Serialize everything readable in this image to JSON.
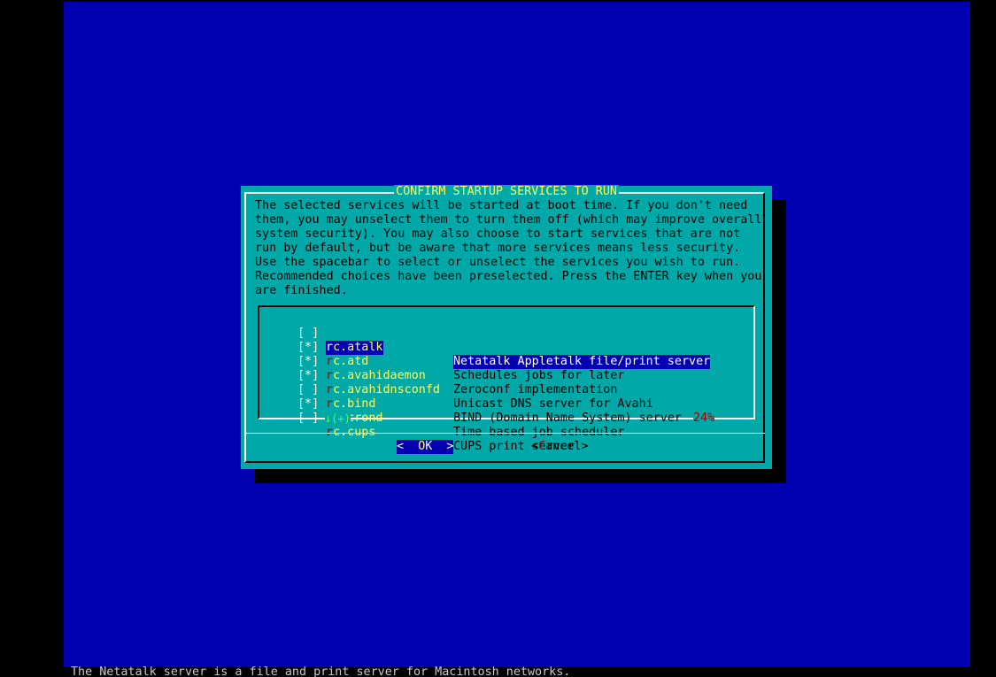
{
  "dialog": {
    "title": "CONFIRM STARTUP SERVICES TO RUN",
    "description_lines": [
      "The selected services will be started at boot time. If you don't need",
      "them, you may unselect them to turn them off (which may improve overall",
      "system security). You may also choose to start services that are not",
      "run by default, but be aware that more services means less security.",
      "Use the spacebar to select or unselect the services you wish to run.",
      "Recommended choices have been preselected. Press the ENTER key when you",
      "are finished."
    ],
    "services": [
      {
        "checked": false,
        "check": "[ ]",
        "tag_first": "r",
        "tag_rest": "c.atalk",
        "description": "Netatalk Appletalk file/print server",
        "selected": true
      },
      {
        "checked": true,
        "check": "[*]",
        "tag_first": "r",
        "tag_rest": "c.atd",
        "description": "Schedules jobs for later",
        "selected": false
      },
      {
        "checked": true,
        "check": "[*]",
        "tag_first": "r",
        "tag_rest": "c.avahidaemon",
        "description": "Zeroconf implementation",
        "selected": false
      },
      {
        "checked": true,
        "check": "[*]",
        "tag_first": "r",
        "tag_rest": "c.avahidnsconfd",
        "description": "Unicast DNS server for Avahi",
        "selected": false
      },
      {
        "checked": false,
        "check": "[ ]",
        "tag_first": "r",
        "tag_rest": "c.bind",
        "description": "BIND (Domain Name System) server",
        "selected": false
      },
      {
        "checked": true,
        "check": "[*]",
        "tag_first": "r",
        "tag_rest": "c.crond",
        "description": "Time based job scheduler",
        "selected": false
      },
      {
        "checked": false,
        "check": "[ ]",
        "tag_first": "r",
        "tag_rest": "c.cups",
        "description": "CUPS print server",
        "selected": false
      }
    ],
    "scroll_indicator": "↓(+)",
    "scroll_percent": "24%",
    "ok_button": {
      "left": "<  ",
      "hot": "O",
      "rest": "K  >"
    },
    "cancel_button": {
      "left": "<",
      "hot": "C",
      "rest": "ancel>"
    }
  },
  "status_line": "The Netatalk server is a file and print server for Macintosh networks.",
  "colors": {
    "screen_bg": "#0000b0",
    "dialog_bg": "#00a8a8",
    "title": "#ffff55",
    "highlight": "#0000b0",
    "hotkey": "#a80000",
    "tag": "#ffff55",
    "scroll_indicator": "#55ff55"
  }
}
